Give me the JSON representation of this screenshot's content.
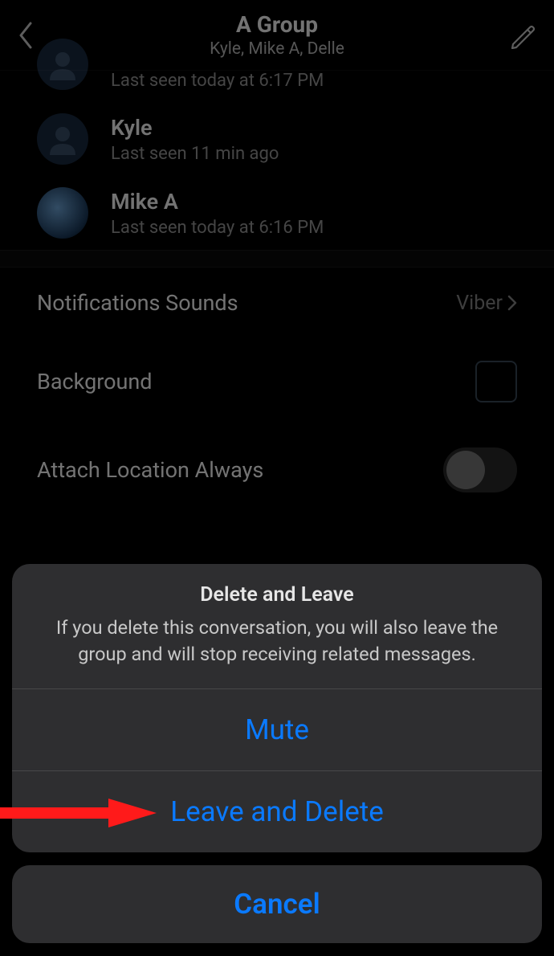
{
  "header": {
    "title": "A Group",
    "subtitle": "Kyle, Mike A, Delle"
  },
  "members": [
    {
      "name": "",
      "status": "Last seen today at 6:17 PM",
      "avatar": "default-partial"
    },
    {
      "name": "Kyle",
      "status": "Last seen 11 min ago",
      "avatar": "default"
    },
    {
      "name": "Mike A",
      "status": "Last seen today at 6:16 PM",
      "avatar": "earth"
    }
  ],
  "settings": {
    "notification_sounds": {
      "label": "Notifications Sounds",
      "value": "Viber"
    },
    "background": {
      "label": "Background"
    },
    "attach_location": {
      "label": "Attach Location Always",
      "on": false
    }
  },
  "sheet": {
    "title": "Delete and Leave",
    "message": "If you delete this conversation, you will also leave the group and will stop receiving related messages.",
    "mute_label": "Mute",
    "leave_label": "Leave and Delete",
    "cancel_label": "Cancel"
  }
}
